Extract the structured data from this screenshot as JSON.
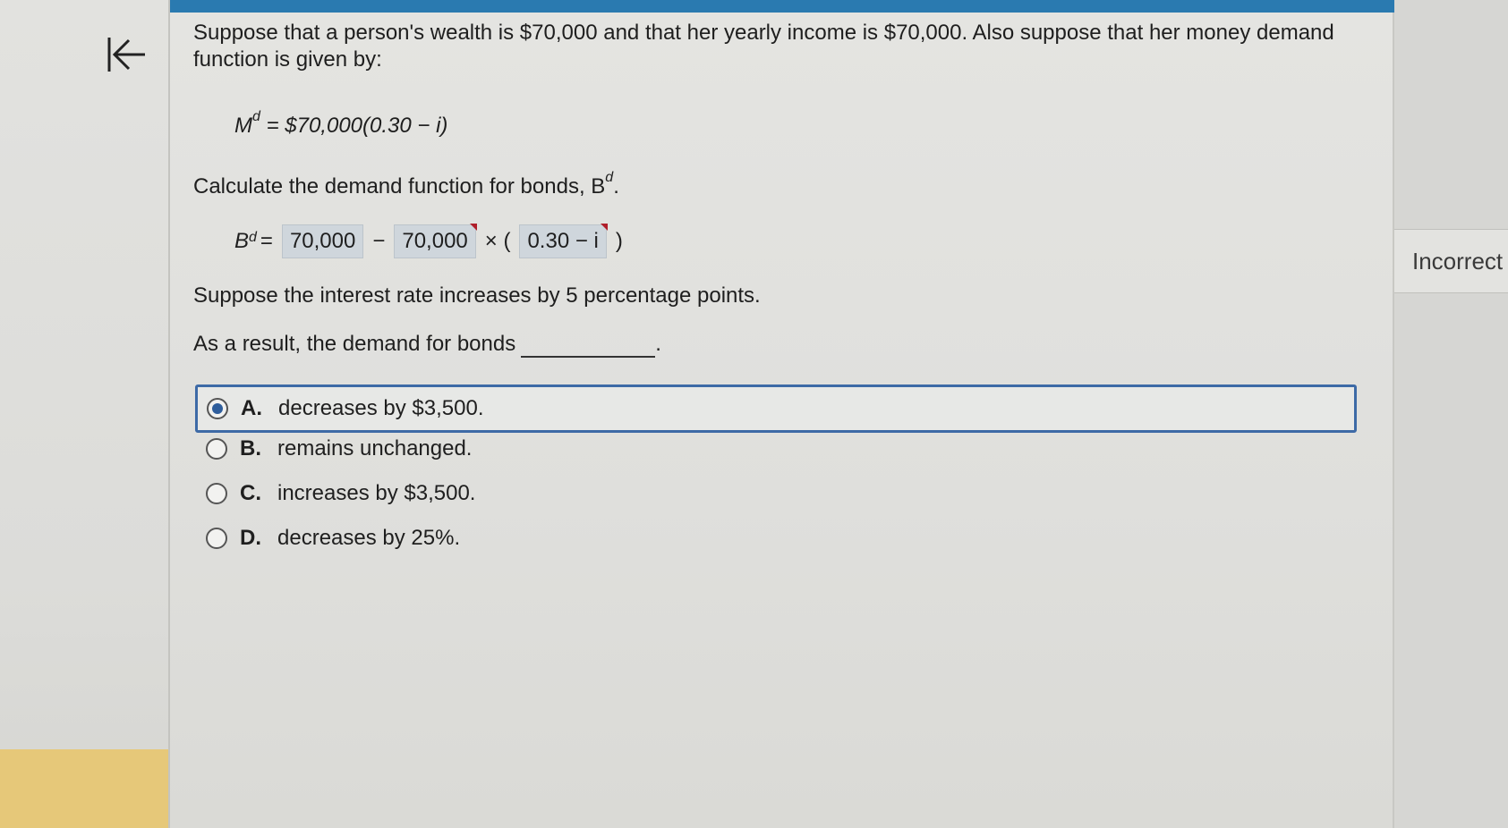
{
  "nav": {
    "back_icon": "first-page-arrow-icon"
  },
  "question": {
    "intro_line1": "Suppose that a person's wealth is $70,000 and that her yearly income is $70,000. Also suppose that her money demand",
    "intro_line2": "function is given by:",
    "money_demand_lhs": "M",
    "money_demand_sup": "d",
    "money_demand_rhs": "= $70,000(0.30 − i)",
    "bond_prompt": "Calculate the demand function for bonds, B",
    "bond_prompt_sup": "d",
    "bond_prompt_end": ".",
    "bond_lhs": "B",
    "bond_sup": "d",
    "eq_sign": "=",
    "answer1": "70,000",
    "minus": "−",
    "answer2": "70,000",
    "times": "× (",
    "answer3": "0.30 − i",
    "close_paren": ")",
    "rate_change": "Suppose the interest rate increases by 5 percentage points.",
    "result_prompt": "As a result, the demand for bonds",
    "result_end": "."
  },
  "options": [
    {
      "letter": "A.",
      "text": "decreases by $3,500.",
      "selected": true
    },
    {
      "letter": "B.",
      "text": "remains unchanged.",
      "selected": false
    },
    {
      "letter": "C.",
      "text": "increases by $3,500.",
      "selected": false
    },
    {
      "letter": "D.",
      "text": "decreases by 25%.",
      "selected": false
    }
  ],
  "status": {
    "label": "Incorrect"
  },
  "colors": {
    "top_bar": "#2a7ab0",
    "selection_border": "#3d6aa6",
    "error_flag": "#b01e2a",
    "left_accent": "#e6c879"
  }
}
